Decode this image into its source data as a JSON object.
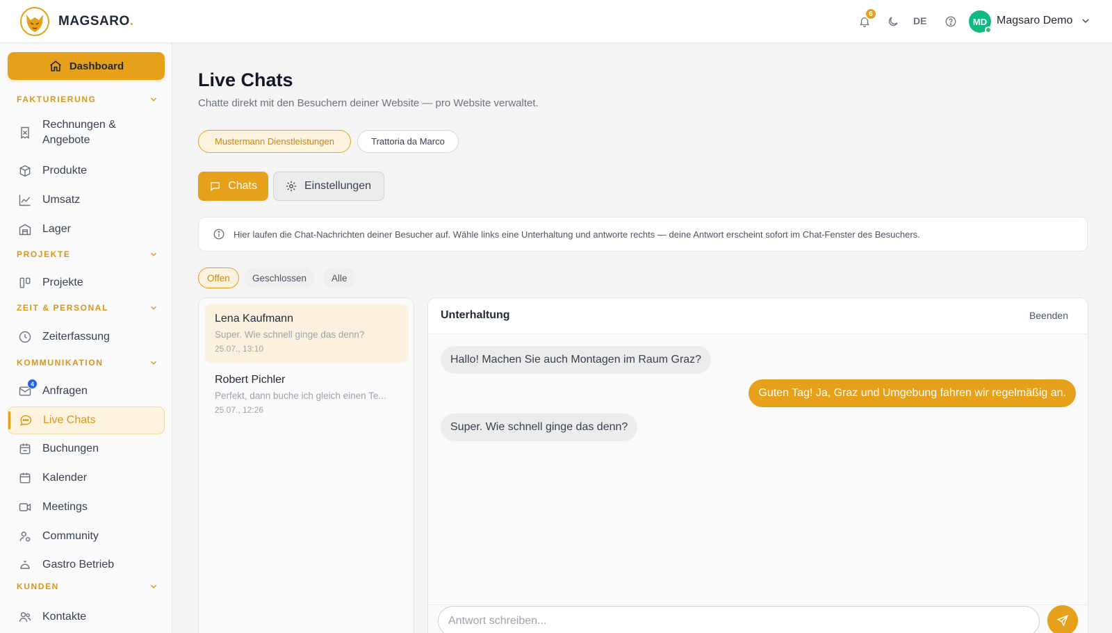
{
  "colors": {
    "accent": "#e6a019",
    "accent_soft": "#fdf3df",
    "online": "#22c55e",
    "avatar_bg": "#10b981",
    "badge_blue": "#2563eb"
  },
  "header": {
    "brand": "MAGSARO",
    "brand_dot": ".",
    "notifications_count": "6",
    "language": "DE",
    "avatar_initials": "MD",
    "user_name": "Magsaro Demo",
    "icons": [
      "bell-icon",
      "moon-icon",
      "help-icon",
      "chevron-down-icon"
    ]
  },
  "sidebar": {
    "dashboard_label": "Dashboard",
    "sections": {
      "fakturierung": "FAKTURIERUNG",
      "projekte": "PROJEKTE",
      "zeit": "ZEIT & PERSONAL",
      "kommunikation": "KOMMUNIKATION",
      "kunden": "KUNDEN"
    },
    "items": {
      "rechnungen_line1": "Rechnungen &",
      "rechnungen_line2": "Angebote",
      "produkte": "Produkte",
      "umsatz": "Umsatz",
      "lager": "Lager",
      "projekte": "Projekte",
      "zeiterfassung": "Zeiterfassung",
      "anfragen": "Anfragen",
      "anfragen_badge": "4",
      "live_chats": "Live Chats",
      "buchungen": "Buchungen",
      "kalender": "Kalender",
      "meetings": "Meetings",
      "community": "Community",
      "gastro": "Gastro Betrieb",
      "kontakte": "Kontakte"
    }
  },
  "main": {
    "title": "Live Chats",
    "subtitle": "Chatte direkt mit den Besuchern deiner Website — pro Website verwaltet.",
    "websites": [
      "Mustermann Dienstleistungen",
      "Trattoria da Marco"
    ],
    "tabs": {
      "chats": "Chats",
      "settings": "Einstellungen"
    },
    "info": "Hier laufen die Chat-Nachrichten deiner Besucher auf. Wähle links eine Unterhaltung und antworte rechts — deine Antwort erscheint sofort im Chat-Fenster des Besuchers.",
    "filters": [
      "Offen",
      "Geschlossen",
      "Alle"
    ],
    "conversations": [
      {
        "name": "Lena Kaufmann",
        "preview": "Super. Wie schnell ginge das denn?",
        "time": "25.07., 13:10"
      },
      {
        "name": "Robert Pichler",
        "preview": "Perfekt, dann buche ich gleich einen Te...",
        "time": "25.07., 12:26"
      }
    ],
    "chat": {
      "title": "Unterhaltung",
      "end_label": "Beenden",
      "messages": [
        {
          "dir": "in",
          "text": "Hallo! Machen Sie auch Montagen im Raum Graz?"
        },
        {
          "dir": "out",
          "text": "Guten Tag! Ja, Graz und Umgebung fahren wir regelmäßig an."
        },
        {
          "dir": "in",
          "text": "Super. Wie schnell ginge das denn?"
        }
      ],
      "reply_placeholder": "Antwort schreiben..."
    }
  }
}
